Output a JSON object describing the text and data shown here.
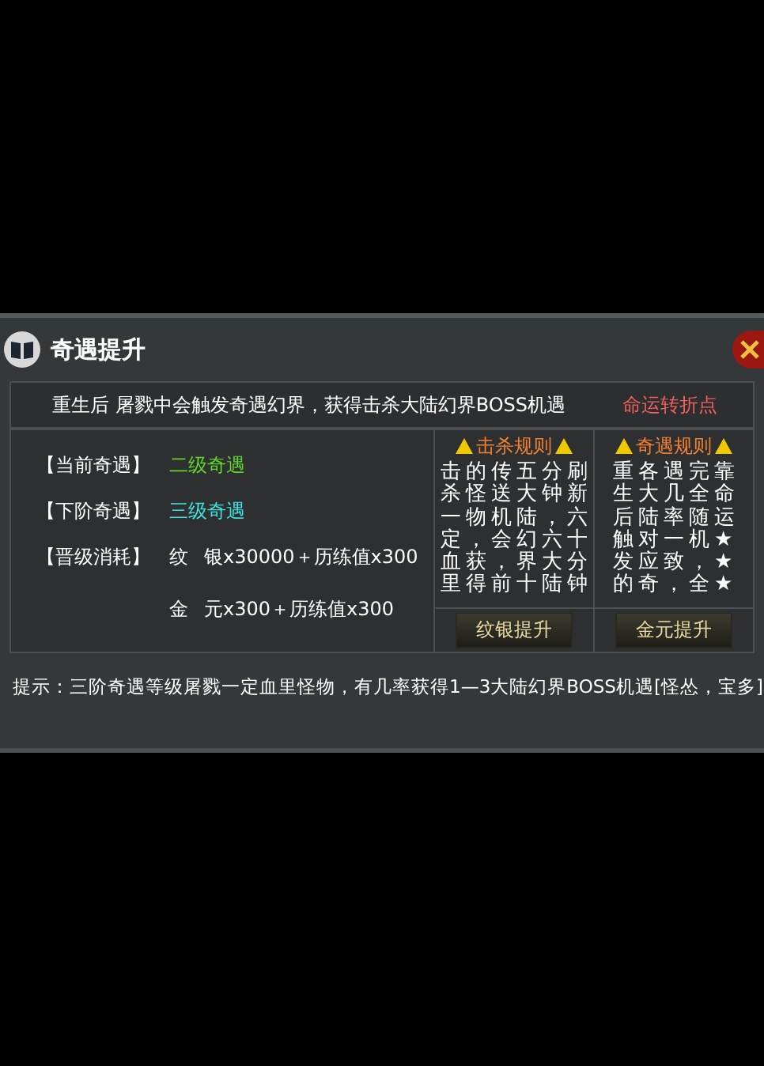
{
  "window": {
    "title": "奇遇提升"
  },
  "header": {
    "text": "重生后 屠戮中会触发奇遇幻界，获得击杀大陆幻界BOSS机遇",
    "link": "命运转折点"
  },
  "info_rows": [
    {
      "label": "【当前奇遇】",
      "value": "二级奇遇",
      "color": "#5fd42a"
    },
    {
      "label": "【下阶奇遇】",
      "value": "三级奇遇",
      "color": "#3fe0e0"
    }
  ],
  "cost": {
    "label": "【晋级消耗】",
    "lines": [
      {
        "currency": "纹",
        "amount": "银x30000＋历练值x300"
      },
      {
        "currency": "金",
        "amount": "元x300＋历练值x300"
      }
    ]
  },
  "rules": [
    {
      "title": "击杀规则",
      "columns": [
        "击杀一定血里",
        "的怪物，获得",
        "传送机会，前",
        "五大陆幻界十",
        "分钟，六大陆",
        "刷新六十分钟"
      ],
      "button": "纹银提升"
    },
    {
      "title": "奇遇规则",
      "columns": [
        "重生后触发的",
        "各大陆对应奇",
        "遇几率一致，",
        "完全随机，全",
        "靠命运★★★"
      ],
      "button": "金元提升"
    }
  ],
  "tip": "提示：三阶奇遇等级屠戮一定血里怪物，有几率获得1—3大陆幻界BOSS机遇[怪怂，宝多]"
}
